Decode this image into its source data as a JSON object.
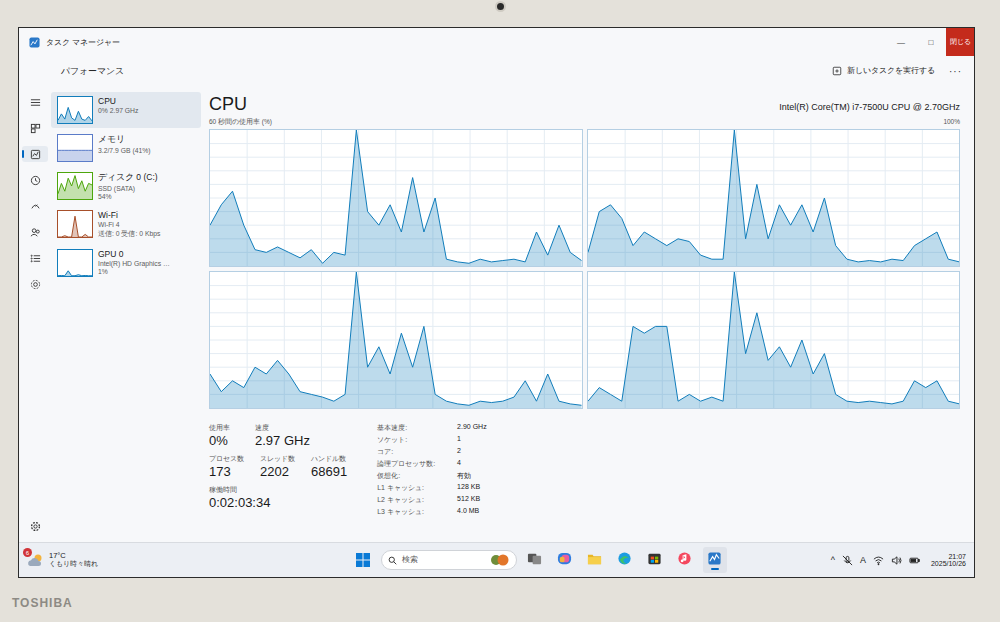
{
  "device": {
    "brand": "TOSHIBA"
  },
  "window": {
    "title": "タスク マネージャー",
    "controls": [
      "—",
      "□"
    ],
    "close_tooltip": "閉じる"
  },
  "header": {
    "title": "パフォーマンス",
    "run_task": "新しいタスクを実行する",
    "more": "···"
  },
  "nav": {
    "items": [
      {
        "kind": "menu",
        "selected": false
      },
      {
        "kind": "processes",
        "selected": false
      },
      {
        "kind": "performance",
        "selected": true
      },
      {
        "kind": "history",
        "selected": false
      },
      {
        "kind": "startup",
        "selected": false
      },
      {
        "kind": "users",
        "selected": false
      },
      {
        "kind": "details",
        "selected": false
      },
      {
        "kind": "services",
        "selected": false
      }
    ],
    "settings": {
      "kind": "settings",
      "selected": false
    }
  },
  "sidebar": {
    "items": [
      {
        "title": "CPU",
        "lines": [
          "0% 2.97 GHz"
        ],
        "selected": true,
        "color": "#117dbb",
        "values": [
          10,
          35,
          15,
          60,
          20,
          10,
          45,
          15,
          10,
          25,
          8
        ]
      },
      {
        "title": "メモリ",
        "lines": [
          "3.2/7.9 GB (41%)"
        ],
        "selected": false,
        "color": "#5a7bc8",
        "values": [
          41,
          41,
          41,
          41,
          41,
          41,
          41,
          41,
          41,
          41,
          41
        ]
      },
      {
        "title": "ディスク 0 (C:)",
        "lines": [
          "SSD (SATA)",
          "54%"
        ],
        "selected": false,
        "color": "#4da60c",
        "values": [
          20,
          60,
          30,
          80,
          50,
          90,
          40,
          70,
          30,
          60,
          54
        ]
      },
      {
        "title": "Wi-Fi",
        "lines": [
          "Wi-Fi 4",
          "送信: 0 受信: 0 Kbps"
        ],
        "selected": false,
        "color": "#a74f2a",
        "values": [
          0,
          0,
          5,
          0,
          0,
          80,
          0,
          0,
          10,
          0,
          0
        ]
      },
      {
        "title": "GPU 0",
        "lines": [
          "Intel(R) HD Graphics …",
          "1%"
        ],
        "selected": false,
        "color": "#117dbb",
        "values": [
          1,
          2,
          1,
          20,
          1,
          1,
          5,
          1,
          2,
          1,
          1
        ]
      }
    ]
  },
  "cpu": {
    "title": "CPU",
    "model": "Intel(R) Core(TM) i7-7500U CPU @ 2.70GHz",
    "axis_label": "60 秒間の使用率 (%)",
    "axis_max": "100%",
    "graphs": [
      {
        "values": [
          30,
          45,
          55,
          30,
          12,
          10,
          14,
          10,
          6,
          12,
          2,
          10,
          8,
          100,
          40,
          30,
          45,
          25,
          65,
          25,
          50,
          5,
          3,
          2,
          5,
          3,
          4,
          5,
          3,
          25,
          8,
          30,
          10,
          4
        ]
      },
      {
        "values": [
          10,
          40,
          45,
          35,
          15,
          25,
          20,
          15,
          20,
          18,
          8,
          5,
          5,
          100,
          20,
          60,
          20,
          45,
          30,
          45,
          25,
          50,
          15,
          5,
          3,
          4,
          3,
          5,
          4,
          15,
          20,
          25,
          5,
          3
        ]
      },
      {
        "values": [
          25,
          12,
          20,
          15,
          30,
          25,
          35,
          25,
          12,
          10,
          8,
          5,
          10,
          100,
          30,
          45,
          25,
          55,
          30,
          60,
          10,
          5,
          3,
          2,
          5,
          4,
          5,
          8,
          20,
          5,
          25,
          5,
          3,
          2
        ]
      },
      {
        "values": [
          5,
          15,
          10,
          5,
          60,
          55,
          60,
          60,
          5,
          10,
          5,
          8,
          5,
          100,
          40,
          70,
          35,
          45,
          30,
          50,
          25,
          40,
          10,
          5,
          4,
          5,
          4,
          3,
          5,
          20,
          15,
          20,
          5,
          3
        ]
      }
    ],
    "stat_rows": [
      [
        {
          "label": "使用率",
          "value": "0%"
        },
        {
          "label": "速度",
          "value": "2.97 GHz"
        }
      ],
      [
        {
          "label": "プロセス数",
          "value": "173"
        },
        {
          "label": "スレッド数",
          "value": "2202"
        },
        {
          "label": "ハンドル数",
          "value": "68691"
        }
      ],
      [
        {
          "label": "稼働時間",
          "value": "0:02:03:34"
        }
      ]
    ],
    "details": [
      {
        "label": "基本速度:",
        "value": "2.90 GHz"
      },
      {
        "label": "ソケット:",
        "value": "1"
      },
      {
        "label": "コア:",
        "value": "2"
      },
      {
        "label": "論理プロセッサ数:",
        "value": "4"
      },
      {
        "label": "仮想化:",
        "value": "有効"
      },
      {
        "label": "L1 キャッシュ:",
        "value": "128 KB"
      },
      {
        "label": "L2 キャッシュ:",
        "value": "512 KB"
      },
      {
        "label": "L3 キャッシュ:",
        "value": "4.0 MB"
      }
    ]
  },
  "taskbar": {
    "weather": {
      "temp": "17°C",
      "text": "くもり時々晴れ",
      "badge": "6"
    },
    "search": {
      "placeholder": "検索"
    },
    "apps": [
      {
        "kind": "taskview",
        "selected": false
      },
      {
        "kind": "copilot",
        "selected": false
      },
      {
        "kind": "explorer",
        "selected": false
      },
      {
        "kind": "edge",
        "selected": false
      },
      {
        "kind": "store",
        "selected": false
      },
      {
        "kind": "music",
        "selected": false
      },
      {
        "kind": "taskmanager",
        "selected": true
      }
    ],
    "tray": {
      "chevron": "^",
      "ime": "A",
      "icons": [
        {
          "kind": "mic-off"
        },
        {
          "kind": "wifi"
        },
        {
          "kind": "volume"
        },
        {
          "kind": "battery"
        }
      ]
    },
    "clock": {
      "time": "21:07",
      "date": "2025/10/26"
    }
  }
}
